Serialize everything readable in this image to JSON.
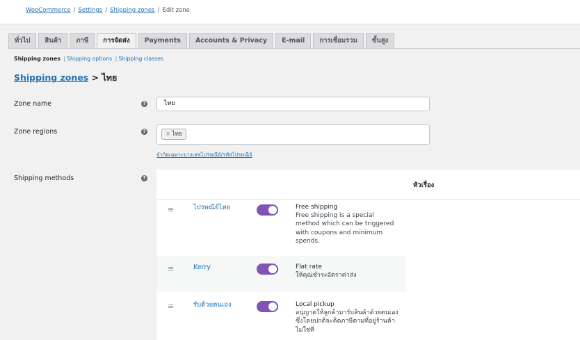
{
  "breadcrumb": {
    "woocommerce": "WooCommerce",
    "settings": "Settings",
    "shipping_zones": "Shipping zones",
    "current": "Edit zone",
    "separator": "/"
  },
  "tabs": [
    {
      "label": "ทั่วไป",
      "active": false
    },
    {
      "label": "สินค้า",
      "active": false
    },
    {
      "label": "ภาษี",
      "active": false
    },
    {
      "label": "การจัดส่ง",
      "active": true
    },
    {
      "label": "Payments",
      "active": false
    },
    {
      "label": "Accounts & Privacy",
      "active": false
    },
    {
      "label": "E-mail",
      "active": false
    },
    {
      "label": "การเชื่อมรวม",
      "active": false
    },
    {
      "label": "ขั้นสูง",
      "active": false
    }
  ],
  "subnav": {
    "current": "Shipping zones",
    "separator": "|",
    "options": "Shipping options",
    "classes": "Shipping classes"
  },
  "heading": {
    "link": "Shipping zones",
    "arrow": ">",
    "zone": "ไทย"
  },
  "form": {
    "zone_name_label": "Zone name",
    "zone_name_value": "ไทย",
    "zone_regions_label": "Zone regions",
    "region_chip": "ไทย",
    "region_chip_remove": "×",
    "limit_link": "จำกัดเฉพาะบางเลขไปรษณีย์/รหัสไปรษณีย์",
    "shipping_methods_label": "Shipping methods",
    "help_glyph": "?"
  },
  "methods": {
    "column_header": "หัวเรื่อง",
    "drag_glyph": "≡",
    "items": [
      {
        "name": "ไปรษณีย์ไทย",
        "enabled": true,
        "title": "Free shipping",
        "description": "Free shipping is a special method which can be triggered with coupons and minimum spends."
      },
      {
        "name": "Kerry",
        "enabled": true,
        "title": "Flat rate",
        "description": "ให้คุณชำระอัตราค่าส่ง"
      },
      {
        "name": "รับด้วยตนเอง",
        "enabled": true,
        "title": "Local pickup",
        "description": "อนุญาตให้ลูกค้ามารับสินค้าด้วยตนเอง ซึ่งโดยปกติจะคิดภาษีตามที่อยู่ร้านค้า ไม่ใช่ที่"
      }
    ]
  },
  "colors": {
    "link": "#2271b1",
    "toggle_on": "#7f54b3"
  }
}
